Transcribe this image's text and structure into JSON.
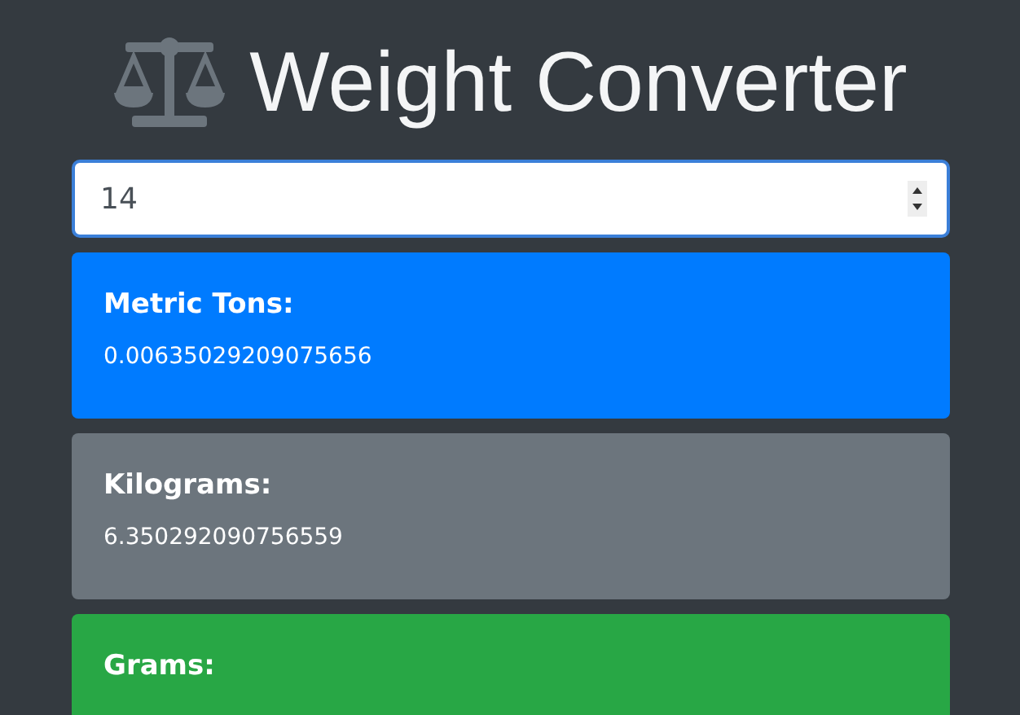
{
  "title": "Weight Converter",
  "input": {
    "value": "14"
  },
  "results": [
    {
      "label": "Metric Tons:",
      "value": "0.00635029209075656",
      "color": "#007bff"
    },
    {
      "label": "Kilograms:",
      "value": "6.350292090756559",
      "color": "#6c757d"
    },
    {
      "label": "Grams:",
      "color": "#28a745"
    }
  ]
}
